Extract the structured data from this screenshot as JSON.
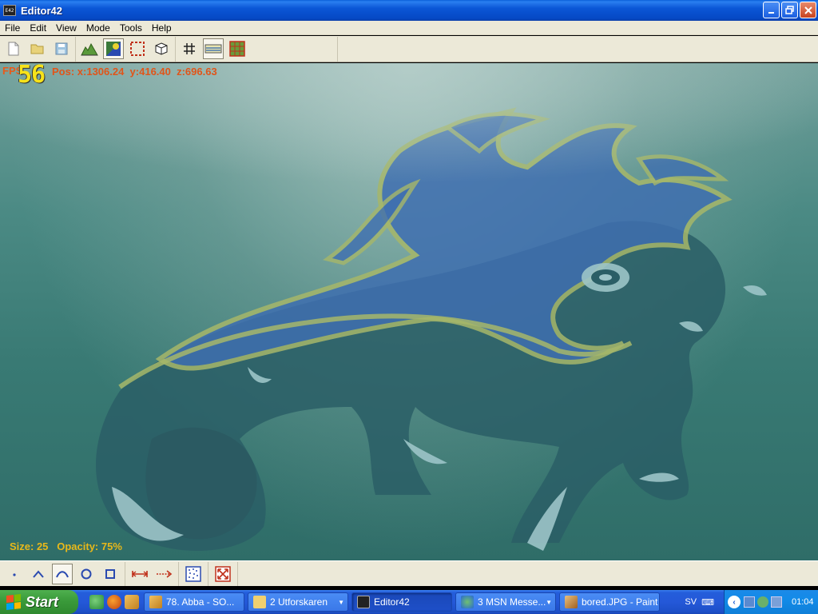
{
  "window": {
    "title": "Editor42",
    "app_icon_text": "E42"
  },
  "menu": {
    "items": [
      "File",
      "Edit",
      "View",
      "Mode",
      "Tools",
      "Help"
    ]
  },
  "toolbar": {
    "buttons": [
      "new-file-icon",
      "open-folder-icon",
      "save-disk-icon",
      "terrain-height-icon",
      "texture-paint-icon",
      "selection-rect-icon",
      "cube-object-icon",
      "grid-icon",
      "water-plane-icon",
      "tile-grid-icon"
    ],
    "pressed": "texture-paint-icon"
  },
  "hud": {
    "fps_label": "FPS",
    "fps_value": "56",
    "position": "Pos: x:1306.24  y:416.40  z:696.63",
    "brush": "Size: 25   Opacity: 75%"
  },
  "bottom_toolbar": {
    "tools": [
      "point-icon",
      "angle-icon",
      "curve-icon",
      "circle-icon",
      "square-icon",
      "line-endpoints-icon",
      "arrow-line-icon",
      "noise-pattern-icon",
      "fit-view-icon"
    ],
    "pressed": "curve-icon"
  },
  "taskbar": {
    "start_label": "Start",
    "tasks": [
      {
        "label": "78. Abba - SO...",
        "icon": "media-player-icon",
        "active": false
      },
      {
        "label": "2 Utforskaren",
        "icon": "folder-icon",
        "active": false,
        "grouped": true
      },
      {
        "label": "Editor42",
        "icon": "editor-icon",
        "active": true
      },
      {
        "label": "3 MSN Messe...",
        "icon": "msn-icon",
        "active": false,
        "grouped": true
      },
      {
        "label": "bored.JPG - Paint",
        "icon": "paint-icon",
        "active": false
      }
    ],
    "language": "SV",
    "clock": "01:04"
  },
  "colors": {
    "ground": "#397a74",
    "creature_dark": "#2a5e66",
    "creature_blue": "#3f6fb0",
    "outline_yellow": "#a6b76a",
    "highlight": "#9cc4c8"
  }
}
